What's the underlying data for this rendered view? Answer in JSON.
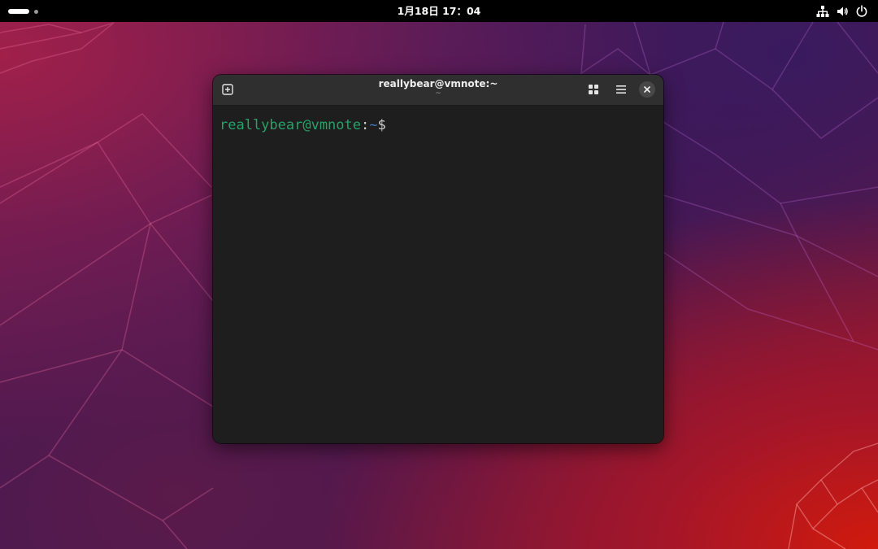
{
  "topbar": {
    "clock": "1月18日  17：04",
    "icons": [
      "network-icon",
      "volume-icon",
      "power-icon"
    ]
  },
  "terminal": {
    "title": "reallybear@vmnote:~",
    "subtitle": "~",
    "prompt": {
      "user_host": "reallybear@vmnote",
      "separator": ":",
      "path": "~",
      "symbol": "$"
    },
    "colors": {
      "user_host": "#26a269",
      "path": "#3d7ab8",
      "background": "#1e1e1e",
      "headerbar": "#2f2f2f"
    }
  }
}
